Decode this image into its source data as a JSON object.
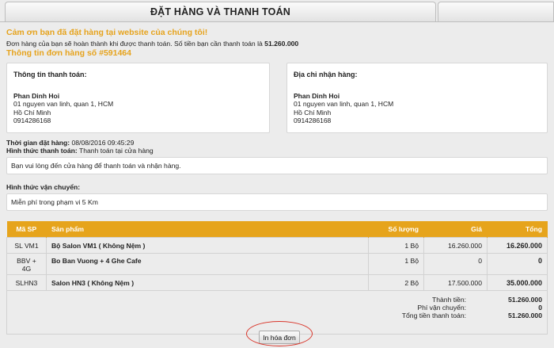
{
  "page": {
    "title": "ĐẶT HÀNG VÀ THANH TOÁN"
  },
  "messages": {
    "thanks": "Cảm ơn bạn đã đặt hàng tại website của chúng tôi!",
    "order_note_prefix": "Đơn hàng của bạn sẽ hoàn thành khi được thanh toán. Số tiền bạn cần thanh toán là ",
    "order_note_amount": "51.260.000",
    "order_info": "Thông tin đơn hàng số #591464"
  },
  "billing": {
    "heading": "Thông tin thanh toán:",
    "name": "Phan Dinh Hoi",
    "address1": "01 nguyen van linh, quan 1, HCM",
    "address2": "Hồ Chí Minh",
    "phone": "0914286168"
  },
  "shipping_address": {
    "heading": "Địa chỉ nhận hàng:",
    "name": "Phan Dinh Hoi",
    "address1": "01 nguyen van linh, quan 1, HCM",
    "address2": "Hồ Chí Minh",
    "phone": "0914286168"
  },
  "order_meta": {
    "time_label": "Thời gian đặt hàng:",
    "time_value": "08/08/2016 09:45:29",
    "payment_label": "Hình thức thanh toán:",
    "payment_value": "Thanh toán tại cửa hàng",
    "payment_note": "Bạn vui lòng đến cửa hàng để thanh toán và nhận hàng.",
    "shipping_label": "Hình thức vận chuyển:",
    "shipping_note": "Miễn phí trong phạm vi 5 Km"
  },
  "table": {
    "headers": {
      "code": "Mã SP",
      "product": "Sản phẩm",
      "qty": "Số lượng",
      "price": "Giá",
      "total": "Tổng"
    },
    "rows": [
      {
        "code": "SL VM1",
        "product": "Bộ Salon VM1 ( Không Nệm )",
        "qty": "1 Bộ",
        "price": "16.260.000",
        "total": "16.260.000"
      },
      {
        "code": "BBV + 4G",
        "product": "Bo Ban Vuong + 4 Ghe Cafe",
        "qty": "1 Bộ",
        "price": "0",
        "total": "0"
      },
      {
        "code": "SLHN3",
        "product": "Salon HN3 ( Không Nệm )",
        "qty": "2 Bộ",
        "price": "17.500.000",
        "total": "35.000.000"
      }
    ],
    "totals": {
      "subtotal_label": "Thành tiền:",
      "subtotal_value": "51.260.000",
      "shipping_label": "Phí vận chuyển:",
      "shipping_value": "0",
      "grand_label": "Tổng tiền thanh toán:",
      "grand_value": "51.260.000"
    }
  },
  "actions": {
    "print_label": "In hóa đơn"
  }
}
